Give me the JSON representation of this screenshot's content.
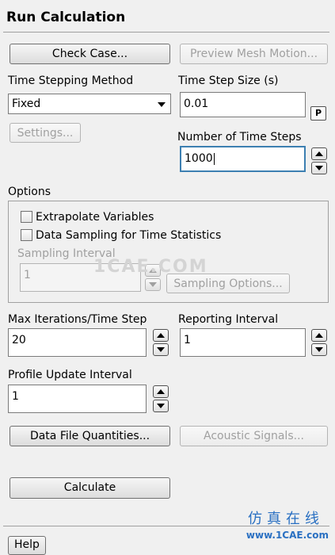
{
  "panel": {
    "title": "Run Calculation"
  },
  "buttons": {
    "check_case": "Check Case...",
    "preview_mesh_motion": "Preview Mesh Motion...",
    "settings": "Settings...",
    "sampling_options": "Sampling Options...",
    "data_file_quantities": "Data File Quantities...",
    "acoustic_signals": "Acoustic Signals...",
    "calculate": "Calculate",
    "help": "Help"
  },
  "time_stepping": {
    "method_label": "Time Stepping Method",
    "method_value": "Fixed",
    "step_size_label": "Time Step Size (s)",
    "step_size_value": "0.01",
    "param_button": "P",
    "num_steps_label": "Number of Time Steps",
    "num_steps_value": "1000"
  },
  "options": {
    "label": "Options",
    "extrapolate_variables": "Extrapolate Variables",
    "data_sampling": "Data Sampling for Time Statistics",
    "sampling_interval_label": "Sampling Interval",
    "sampling_interval_value": "1"
  },
  "iteration": {
    "max_iter_label": "Max Iterations/Time Step",
    "max_iter_value": "20",
    "reporting_label": "Reporting Interval",
    "reporting_value": "1",
    "profile_label": "Profile Update Interval",
    "profile_value": "1"
  },
  "watermark": {
    "center": "1CAE.COM",
    "chinese": "仿真在线",
    "url": "www.1CAE.com"
  }
}
